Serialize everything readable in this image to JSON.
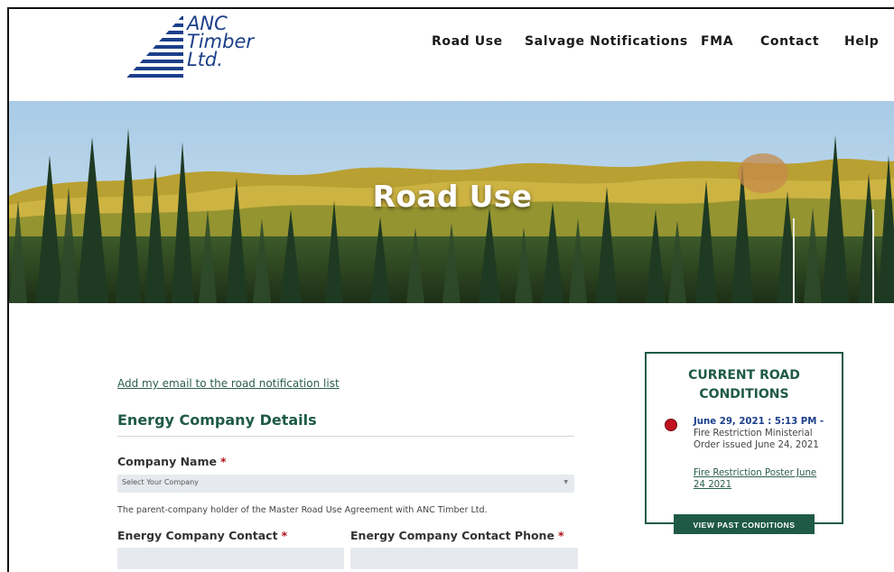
{
  "brand": {
    "line1": "ANC",
    "line2": "Timber",
    "line3": "Ltd.",
    "color": "#1b3f8a"
  },
  "nav": {
    "items": [
      "Road Use",
      "Salvage Notifications",
      "FMA",
      "Contact",
      "Help"
    ]
  },
  "hero": {
    "title": "Road Use"
  },
  "form": {
    "email_link": "Add my email to the road notification list",
    "section_title": "Energy Company Details",
    "company_label": "Company Name",
    "required_mark": "*",
    "company_placeholder": "Select Your Company",
    "company_help": "The parent-company holder of the Master Road Use Agreement with ANC Timber Ltd.",
    "contact_label": "Energy Company Contact",
    "phone_label": "Energy Company Contact Phone",
    "contact_value": "",
    "phone_value": ""
  },
  "conditions": {
    "title_line1": "CURRENT ROAD",
    "title_line2": "CONDITIONS",
    "status_color": "#c1121f",
    "status_icon": "red-dot-icon",
    "update_time": "June 29, 2021 : 5:13 PM -",
    "update_text": "Fire Restriction Ministerial Order issued June 24, 2021",
    "poster_link": "Fire Restriction Poster June 24 2021",
    "past_button": "VIEW PAST CONDITIONS"
  },
  "colors": {
    "accent_green": "#1f5a46",
    "brand_blue": "#1b3f8a",
    "required_red": "#b0121b"
  }
}
